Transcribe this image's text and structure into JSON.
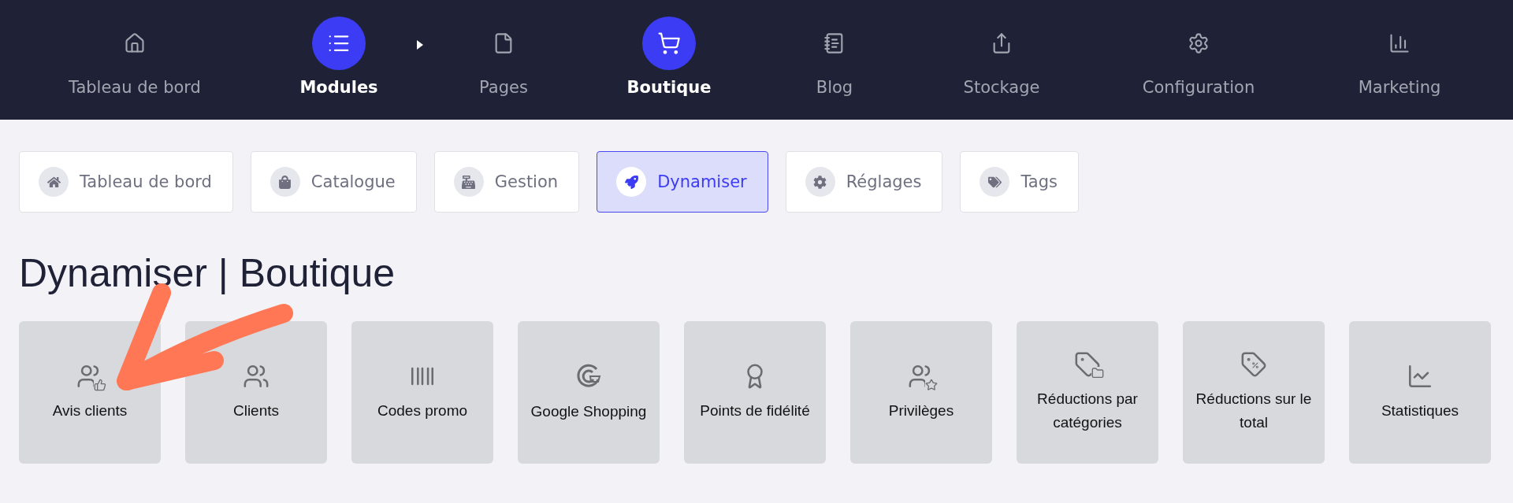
{
  "top_nav": [
    {
      "label": "Tableau de bord",
      "selected": false
    },
    {
      "label": "Modules",
      "selected": true
    },
    {
      "label": "Pages",
      "selected": false
    },
    {
      "label": "Boutique",
      "selected": true
    },
    {
      "label": "Blog",
      "selected": false
    },
    {
      "label": "Stockage",
      "selected": false
    },
    {
      "label": "Configuration",
      "selected": false
    },
    {
      "label": "Marketing",
      "selected": false
    }
  ],
  "tabs": [
    {
      "label": "Tableau de bord",
      "selected": false
    },
    {
      "label": "Catalogue",
      "selected": false
    },
    {
      "label": "Gestion",
      "selected": false
    },
    {
      "label": "Dynamiser",
      "selected": true
    },
    {
      "label": "Réglages",
      "selected": false
    },
    {
      "label": "Tags",
      "selected": false
    }
  ],
  "heading": "Dynamiser | Boutique",
  "cards": [
    {
      "label": "Avis clients"
    },
    {
      "label": "Clients"
    },
    {
      "label": "Codes promo"
    },
    {
      "label": "Google Shopping"
    },
    {
      "label": "Points de fidélité"
    },
    {
      "label": "Privilèges"
    },
    {
      "label": "Réductions par catégories"
    },
    {
      "label": "Réductions sur le total"
    },
    {
      "label": "Statistiques"
    }
  ]
}
